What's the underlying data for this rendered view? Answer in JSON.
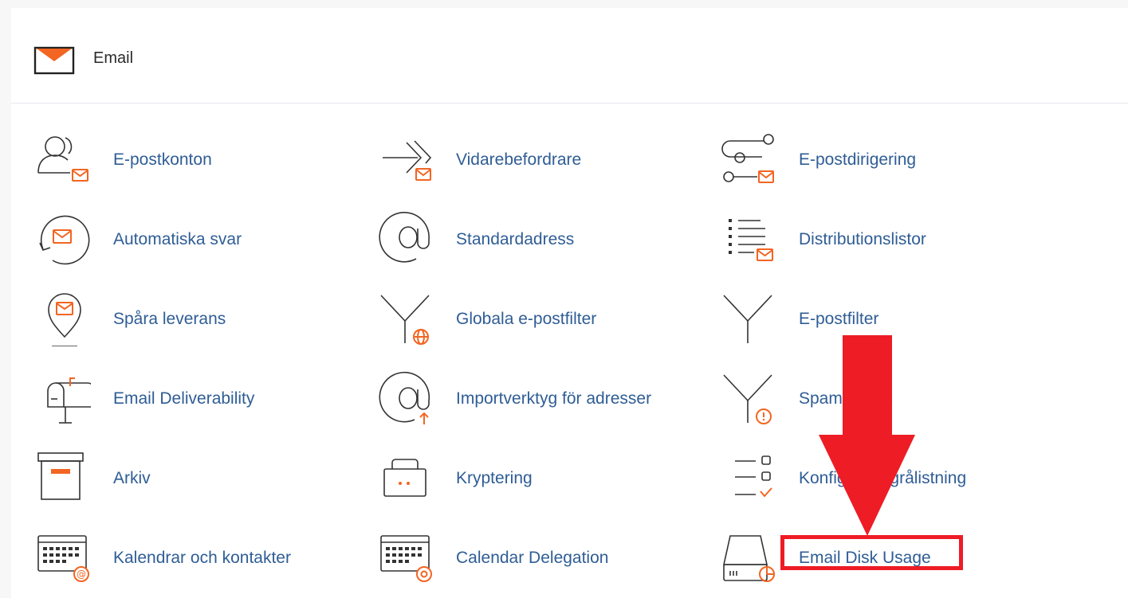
{
  "section": {
    "title": "Email",
    "icon": "envelope-icon"
  },
  "items": [
    {
      "label": "E-postkonton",
      "icon": "email-accounts-icon"
    },
    {
      "label": "Vidarebefordrare",
      "icon": "forwarders-icon"
    },
    {
      "label": "E-postdirigering",
      "icon": "email-routing-icon"
    },
    {
      "label": "Automatiska svar",
      "icon": "autoresponders-icon"
    },
    {
      "label": "Standardadress",
      "icon": "default-address-icon"
    },
    {
      "label": "Distributionslistor",
      "icon": "mailing-lists-icon"
    },
    {
      "label": "Spåra leverans",
      "icon": "track-delivery-icon"
    },
    {
      "label": "Globala e-postfilter",
      "icon": "global-filters-icon"
    },
    {
      "label": "E-postfilter",
      "icon": "email-filters-icon"
    },
    {
      "label": "Email Deliverability",
      "icon": "mailbox-icon"
    },
    {
      "label": "Importverktyg för adresser",
      "icon": "address-importer-icon"
    },
    {
      "label": "Spam Filters",
      "icon": "spam-filters-icon"
    },
    {
      "label": "Arkiv",
      "icon": "archive-icon"
    },
    {
      "label": "Kryptering",
      "icon": "encryption-icon"
    },
    {
      "label": "Konfigurera grålistning",
      "icon": "greylisting-icon"
    },
    {
      "label": "Kalendrar och kontakter",
      "icon": "calendars-contacts-icon"
    },
    {
      "label": "Calendar Delegation",
      "icon": "calendar-delegation-icon"
    },
    {
      "label": "Email Disk Usage",
      "icon": "disk-usage-icon"
    }
  ],
  "annotation": {
    "arrow": "red-arrow",
    "highlighted_item": "Email Disk Usage",
    "color": "#ee1c25"
  },
  "colors": {
    "accent": "#f26522",
    "link": "#2f5d95",
    "icon_stroke": "#333333"
  }
}
